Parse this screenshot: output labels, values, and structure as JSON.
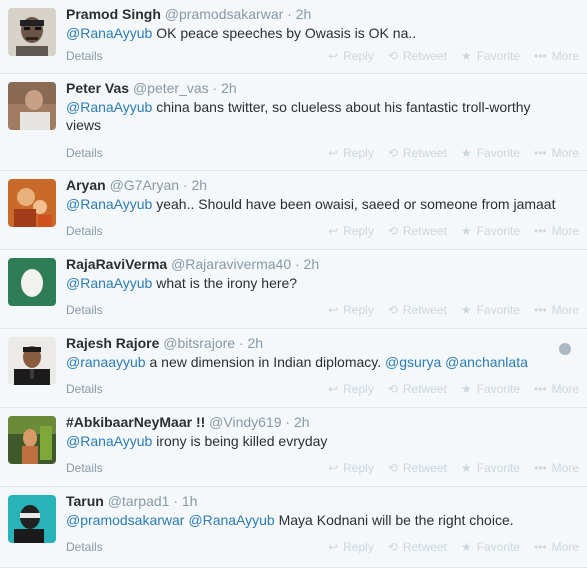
{
  "actions": {
    "details": "Details",
    "reply": "Reply",
    "retweet": "Retweet",
    "favorite": "Favorite",
    "more": "More"
  },
  "tweets": [
    {
      "fullname": "Pramod Singh",
      "meta": "@pramodsakarwar · 2h",
      "mentions": [
        "@RanaAyyub"
      ],
      "text": " OK peace speeches by Owasis is OK na.."
    },
    {
      "fullname": "Peter Vas",
      "meta": "@peter_vas · 2h",
      "mentions": [
        "@RanaAyyub"
      ],
      "text": " china bans twitter, so clueless about his fantastic troll-worthy views"
    },
    {
      "fullname": "Aryan",
      "meta": "@G7Aryan · 2h",
      "mentions": [
        "@RanaAyyub"
      ],
      "text": " yeah.. Should have been owaisi, saeed or someone from jamaat"
    },
    {
      "fullname": "RajaRaviVerma",
      "meta": "@Rajaraviverma40 · 2h",
      "mentions": [
        "@RanaAyyub"
      ],
      "text": " what is the irony here?"
    },
    {
      "fullname": "Rajesh Rajore",
      "meta": "@bitsrajore · 2h",
      "mentions": [
        "@ranaayyub"
      ],
      "text": " a new dimension in Indian diplomacy.",
      "trailing_mentions": [
        "@gsurya",
        "@anchanlata"
      ]
    },
    {
      "fullname": "#AbkibaarNeyMaar !!",
      "meta": "@Vindy619 · 2h",
      "mentions": [
        "@RanaAyyub"
      ],
      "text": " irony is being killed evryday"
    },
    {
      "fullname": "Tarun",
      "meta": "@tarpad1 · 1h",
      "mentions": [
        "@pramodsakarwar",
        "@RanaAyyub"
      ],
      "text": " Maya Kodnani will be the right choice."
    }
  ]
}
